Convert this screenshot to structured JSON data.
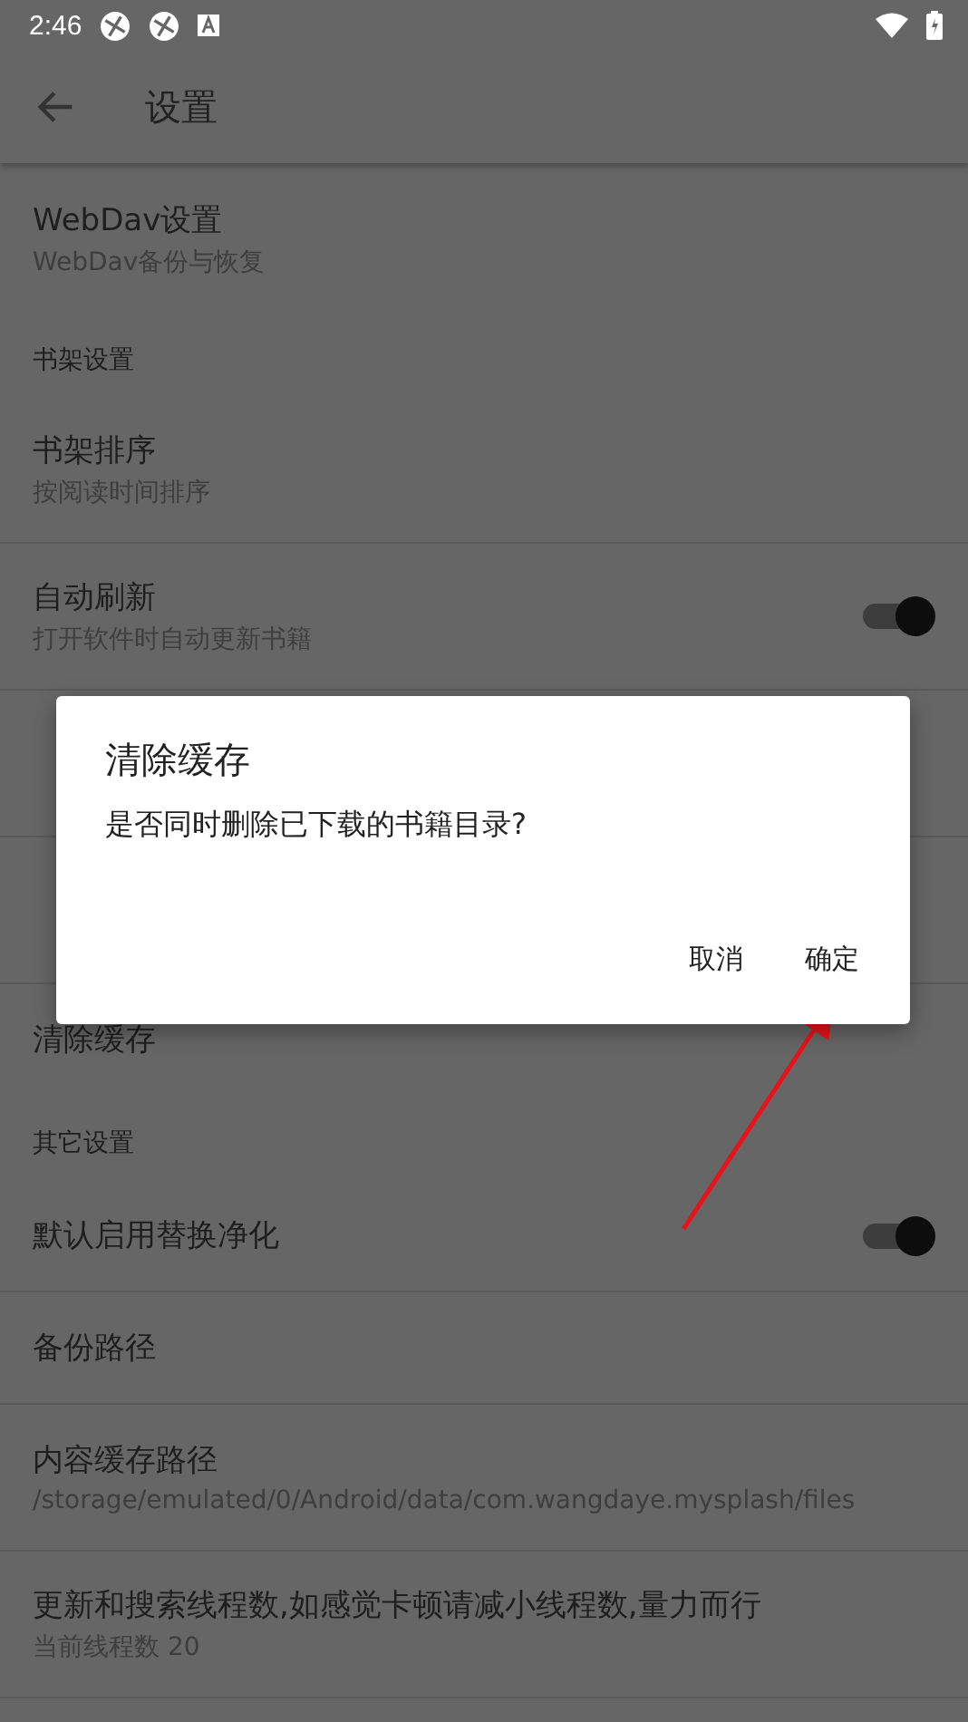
{
  "status_bar": {
    "time": "2:46"
  },
  "toolbar": {
    "title": "设置"
  },
  "items": [
    {
      "kind": "pref",
      "title": "WebDav设置",
      "summary": "WebDav备份与恢复",
      "divider": false
    },
    {
      "kind": "category",
      "title": "书架设置"
    },
    {
      "kind": "pref",
      "title": "书架排序",
      "summary": "按阅读时间排序",
      "divider": true
    },
    {
      "kind": "switch",
      "title": "自动刷新",
      "summary": "打开软件时自动更新书籍",
      "on": true,
      "divider": true
    },
    {
      "kind": "pref",
      "divider": true
    },
    {
      "kind": "pref",
      "divider": true
    },
    {
      "kind": "pref",
      "title": "清除缓存",
      "divider": false
    },
    {
      "kind": "category",
      "title": "其它设置"
    },
    {
      "kind": "switch",
      "title": "默认启用替换净化",
      "on": true,
      "divider": true
    },
    {
      "kind": "pref",
      "title": "备份路径",
      "divider": true
    },
    {
      "kind": "pref",
      "title": "内容缓存路径",
      "summary": "/storage/emulated/0/Android/data/com.wangdaye.mysplash/files",
      "divider": true
    },
    {
      "kind": "pref",
      "title": "更新和搜索线程数,如感觉卡顿请减小线程数,量力而行",
      "summary": "当前线程数 20",
      "divider": true
    }
  ],
  "dialog": {
    "title": "清除缓存",
    "message": "是否同时删除已下载的书籍目录?",
    "buttons": [
      "取消",
      "确定"
    ]
  }
}
